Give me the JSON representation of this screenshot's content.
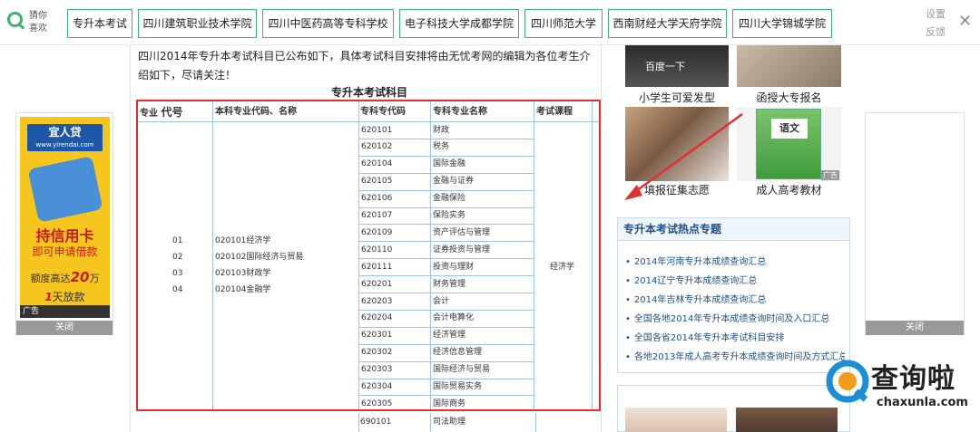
{
  "topbar": {
    "guess_label": "猜你喜欢",
    "tags": [
      "专升本考试",
      "四川建筑职业技术学院",
      "四川中医药高等专科学校",
      "电子科技大学成都学院",
      "四川师范大学",
      "西南财经大学天府学院",
      "四川大学锦城学院"
    ],
    "settings_label": "设置",
    "feedback_label": "反馈",
    "close_glyph": "✕"
  },
  "article": {
    "intro": "四川2014年专升本考试科目已公布如下，具体考试科目安排将由无忧考网的编辑为各位考生介绍如下，尽请关注！",
    "table_title": "专升本考试科目"
  },
  "table": {
    "headers": {
      "col1_small": "专业",
      "col1_big": "代号",
      "col2": "本科专业代码、名称",
      "col3": "专科专代码",
      "col4": "专科专业名称",
      "col5": "考试课程"
    },
    "codes": [
      "01",
      "02",
      "03",
      "04"
    ],
    "majors": [
      "020101经济学",
      "020102国际经济与贸易",
      "020103财政学",
      "020104金融学"
    ],
    "rows": [
      [
        "620101",
        "财政"
      ],
      [
        "620102",
        "税务"
      ],
      [
        "620104",
        "国际金融"
      ],
      [
        "620105",
        "金融与证券"
      ],
      [
        "620106",
        "金融保险"
      ],
      [
        "620107",
        "保险实务"
      ],
      [
        "620109",
        "资产评估与管理"
      ],
      [
        "620110",
        "证券投资与管理"
      ],
      [
        "620111",
        "投资与理财"
      ],
      [
        "620201",
        "财务管理"
      ],
      [
        "620203",
        "会计"
      ],
      [
        "620204",
        "会计电算化"
      ],
      [
        "620301",
        "经济管理"
      ],
      [
        "620302",
        "经济信息管理"
      ],
      [
        "620303",
        "国际经济与贸易"
      ],
      [
        "620304",
        "国际贸易实务"
      ],
      [
        "620305",
        "国际商务"
      ]
    ],
    "exam_course": "经济学",
    "below_row": [
      "690101",
      "司法助理"
    ]
  },
  "right": {
    "baidu_label": "百度一下",
    "captions": [
      "小学生可爱发型",
      "函授大专报名",
      "填报征集志愿",
      "成人高考教材"
    ],
    "ad_badge": "广告",
    "book_title": "语文",
    "hot_title": "专升本考试热点专题",
    "hot_items": [
      "2014年河南专升本成绩查询汇总",
      "2014辽宁专升本成绩查询汇总",
      "2014年吉林专升本成绩查询汇总",
      "全国各地2014年专升本成绩查询时间及入口汇总",
      "全国各省2014年专升本考试科目安排",
      "各地2013年成人高考专升本成绩查询时间及方式汇总"
    ]
  },
  "ad_left": {
    "brand": "宜人贷",
    "url": "www.yirendai.com",
    "line1": "持信用卡",
    "line2": "即可申请借款",
    "line3a": "额度高达",
    "line3b": "20",
    "line3c": "万",
    "line4a": "1",
    "line4b": "天放款",
    "ad_label": "广告",
    "close": "关闭"
  },
  "ad_right": {
    "close": "关闭"
  },
  "watermark": {
    "name": "查询啦",
    "domain": "chaxunla.com"
  },
  "colors": {
    "accent": "#3cb371",
    "highlight_border": "#e03030",
    "link": "#1f4f8a",
    "ad_yellow": "#f6c51e"
  }
}
